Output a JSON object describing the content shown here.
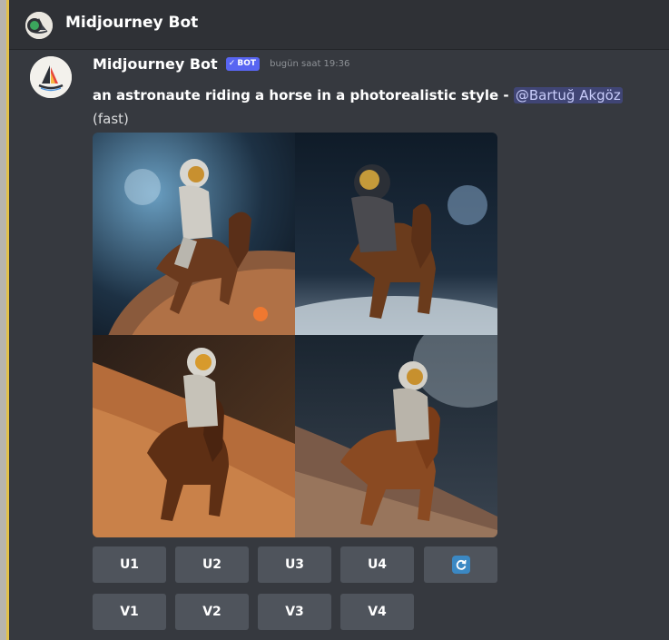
{
  "window": {
    "title": "Midjourney Bot",
    "status_color": "#3ba55d"
  },
  "message": {
    "author": "Midjourney Bot",
    "bot_tag": "BOT",
    "timestamp": "bugün saat 19:36",
    "prompt": "an astronaute riding a horse in a photorealistic style",
    "separator": " - ",
    "mention": "@Bartuğ Akgöz",
    "speed": "(fast)"
  },
  "images": [
    {
      "icon": "astronaut-horse-image-1"
    },
    {
      "icon": "astronaut-horse-image-2"
    },
    {
      "icon": "astronaut-horse-image-3"
    },
    {
      "icon": "astronaut-horse-image-4"
    }
  ],
  "buttons": {
    "upscale": [
      "U1",
      "U2",
      "U3",
      "U4"
    ],
    "variation": [
      "V1",
      "V2",
      "V3",
      "V4"
    ],
    "reroll_icon": "reroll-icon"
  },
  "colors": {
    "background": "#36393f",
    "titlebar": "#2f3136",
    "button": "#4f545c",
    "bot_tag": "#5865f2",
    "mention_bg": "#5865f24d"
  }
}
